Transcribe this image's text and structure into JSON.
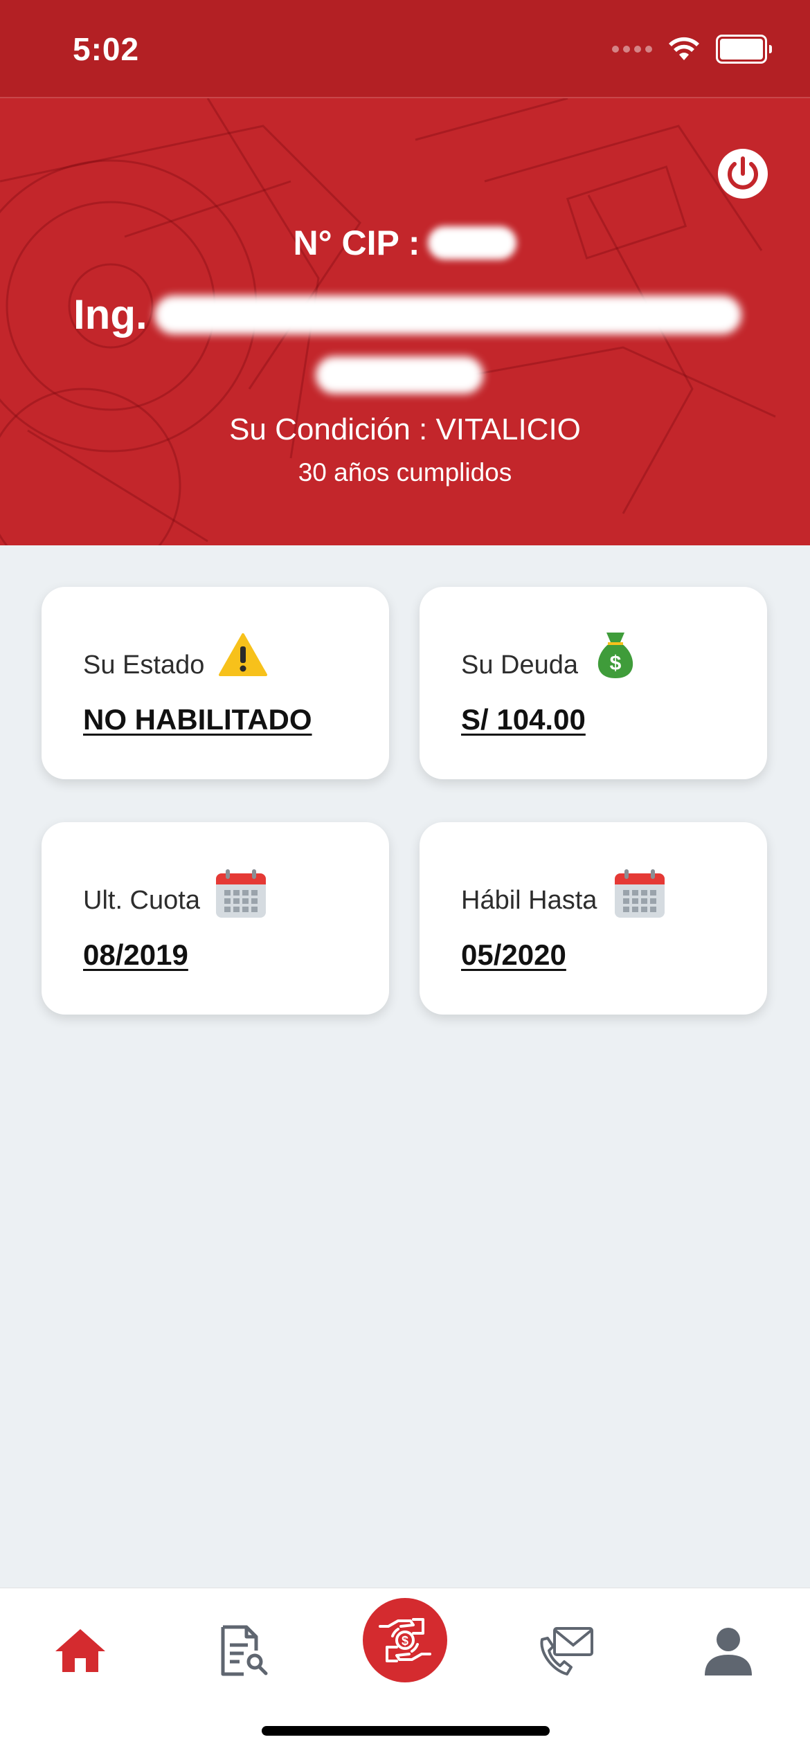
{
  "status_bar": {
    "time": "5:02"
  },
  "header": {
    "cip_label": "N° CIP :",
    "cip_value": "",
    "name_prefix": "Ing.",
    "name_value": "",
    "condition": "Su Condición : VITALICIO",
    "years": "30 años cumplidos"
  },
  "cards": [
    {
      "label": "Su Estado",
      "value": "NO HABILITADO",
      "icon": "warning-icon"
    },
    {
      "label": "Su Deuda",
      "value": "S/ 104.00",
      "icon": "money-bag-icon"
    },
    {
      "label": "Ult. Cuota",
      "value": "08/2019",
      "icon": "calendar-icon"
    },
    {
      "label": "Hábil Hasta",
      "value": "05/2020",
      "icon": "calendar-icon"
    }
  ],
  "tab_bar": {
    "tabs": [
      "home-icon",
      "document-search-icon",
      "payment-icon",
      "contact-icon",
      "profile-icon"
    ],
    "active": "home-icon"
  },
  "colors": {
    "header_red": "#c3262b",
    "status_red": "#b32024",
    "accent_red": "#d42b2f",
    "background": "#ecf0f3",
    "icon_gray": "#5f6670"
  }
}
